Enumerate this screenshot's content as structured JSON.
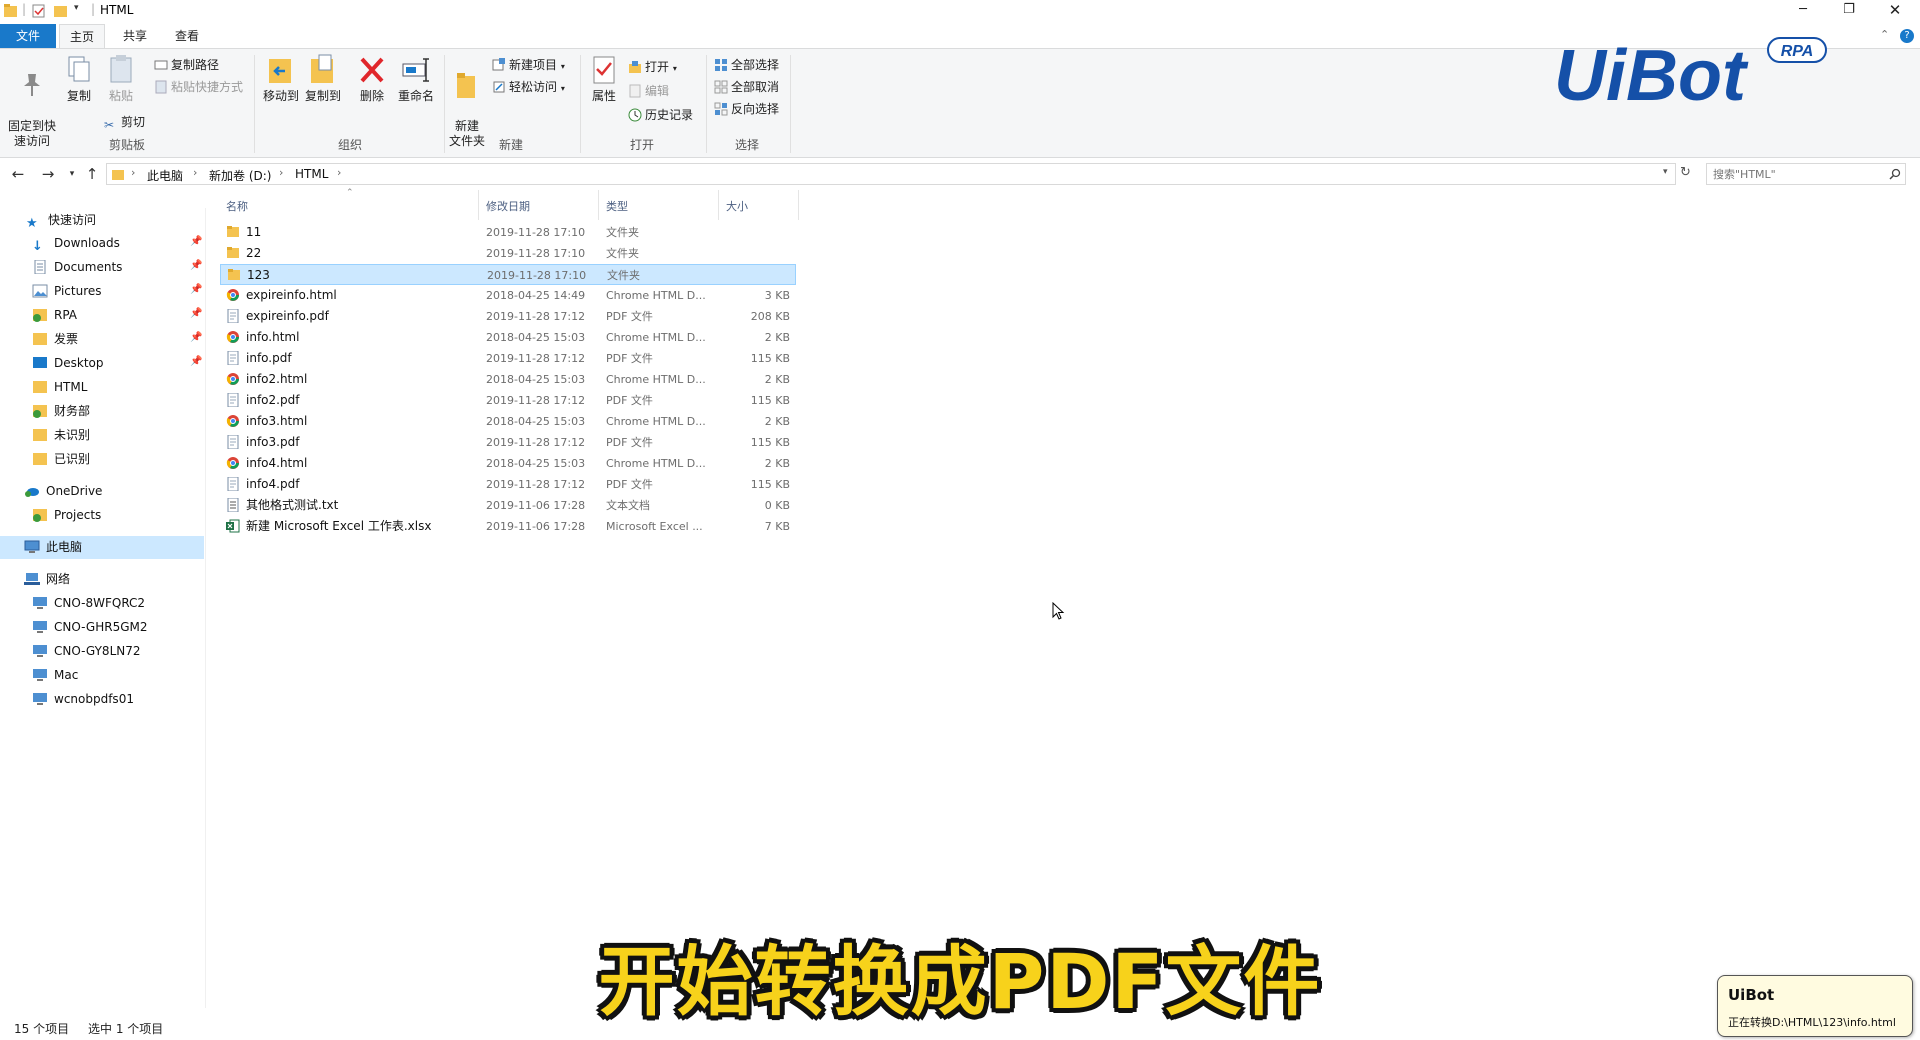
{
  "window": {
    "title": "HTML"
  },
  "ribbon_tabs": [
    "文件",
    "主页",
    "共享",
    "查看"
  ],
  "ribbon": {
    "clipboard": {
      "pin": "固定到快\n速访问",
      "copy": "复制",
      "paste": "粘贴",
      "copy_path": "复制路径",
      "paste_shortcut": "粘贴快捷方式",
      "cut": "剪切",
      "label": "剪贴板"
    },
    "organize": {
      "move_to": "移动到",
      "copy_to": "复制到",
      "delete": "删除",
      "rename": "重命名",
      "label": "组织"
    },
    "new": {
      "new_folder": "新建\n文件夹",
      "new_item": "新建项目",
      "easy_access": "轻松访问",
      "label": "新建"
    },
    "open": {
      "properties": "属性",
      "open": "打开",
      "edit": "编辑",
      "history": "历史记录",
      "label": "打开"
    },
    "select": {
      "select_all": "全部选择",
      "select_none": "全部取消",
      "invert": "反向选择",
      "label": "选择"
    }
  },
  "address": {
    "crumbs": [
      "此电脑",
      "新加卷 (D:)",
      "HTML"
    ],
    "search_placeholder": "搜索\"HTML\""
  },
  "nav": {
    "quick_access": "快速访问",
    "pinned": [
      "Downloads",
      "Documents",
      "Pictures",
      "RPA",
      "发票",
      "Desktop"
    ],
    "others": [
      "HTML",
      "财务部",
      "未识别",
      "已识别"
    ],
    "onedrive": "OneDrive",
    "projects": "Projects",
    "this_pc": "此电脑",
    "network": "网络",
    "network_items": [
      "CNO-8WFQRC2",
      "CNO-GHR5GM2",
      "CNO-GY8LN72",
      "Mac",
      "wcnobpdfs01"
    ]
  },
  "columns": {
    "name": "名称",
    "date": "修改日期",
    "type": "类型",
    "size": "大小"
  },
  "files": [
    {
      "name": "11",
      "date": "2019-11-28 17:10",
      "type": "文件夹",
      "size": "",
      "icon": "folder-icon"
    },
    {
      "name": "22",
      "date": "2019-11-28 17:10",
      "type": "文件夹",
      "size": "",
      "icon": "folder-icon"
    },
    {
      "name": "123",
      "date": "2019-11-28 17:10",
      "type": "文件夹",
      "size": "",
      "icon": "folder-icon",
      "selected": true
    },
    {
      "name": "expireinfo.html",
      "date": "2018-04-25 14:49",
      "type": "Chrome HTML D...",
      "size": "3 KB",
      "icon": "chrome-icon"
    },
    {
      "name": "expireinfo.pdf",
      "date": "2019-11-28 17:12",
      "type": "PDF 文件",
      "size": "208 KB",
      "icon": "pdf-icon"
    },
    {
      "name": "info.html",
      "date": "2018-04-25 15:03",
      "type": "Chrome HTML D...",
      "size": "2 KB",
      "icon": "chrome-icon"
    },
    {
      "name": "info.pdf",
      "date": "2019-11-28 17:12",
      "type": "PDF 文件",
      "size": "115 KB",
      "icon": "pdf-icon"
    },
    {
      "name": "info2.html",
      "date": "2018-04-25 15:03",
      "type": "Chrome HTML D...",
      "size": "2 KB",
      "icon": "chrome-icon"
    },
    {
      "name": "info2.pdf",
      "date": "2019-11-28 17:12",
      "type": "PDF 文件",
      "size": "115 KB",
      "icon": "pdf-icon"
    },
    {
      "name": "info3.html",
      "date": "2018-04-25 15:03",
      "type": "Chrome HTML D...",
      "size": "2 KB",
      "icon": "chrome-icon"
    },
    {
      "name": "info3.pdf",
      "date": "2019-11-28 17:12",
      "type": "PDF 文件",
      "size": "115 KB",
      "icon": "pdf-icon"
    },
    {
      "name": "info4.html",
      "date": "2018-04-25 15:03",
      "type": "Chrome HTML D...",
      "size": "2 KB",
      "icon": "chrome-icon"
    },
    {
      "name": "info4.pdf",
      "date": "2019-11-28 17:12",
      "type": "PDF 文件",
      "size": "115 KB",
      "icon": "pdf-icon"
    },
    {
      "name": "其他格式测试.txt",
      "date": "2019-11-06 17:28",
      "type": "文本文档",
      "size": "0 KB",
      "icon": "text-file-icon"
    },
    {
      "name": "新建 Microsoft Excel 工作表.xlsx",
      "date": "2019-11-06 17:28",
      "type": "Microsoft Excel ...",
      "size": "7 KB",
      "icon": "excel-icon"
    }
  ],
  "status": {
    "count": "15 个项目",
    "selected": "选中 1 个项目"
  },
  "logo": {
    "text": "UiBot",
    "badge": "RPA"
  },
  "caption": "开始转换成PDF文件",
  "toast": {
    "title": "UiBot",
    "message": "正在转换D:\\HTML\\123\\info.html"
  },
  "colors": {
    "accent": "#1979ca",
    "selection": "#cce8ff",
    "folder": "#f4c350",
    "logo": "#1550a8",
    "caption": "#f7d21b"
  }
}
